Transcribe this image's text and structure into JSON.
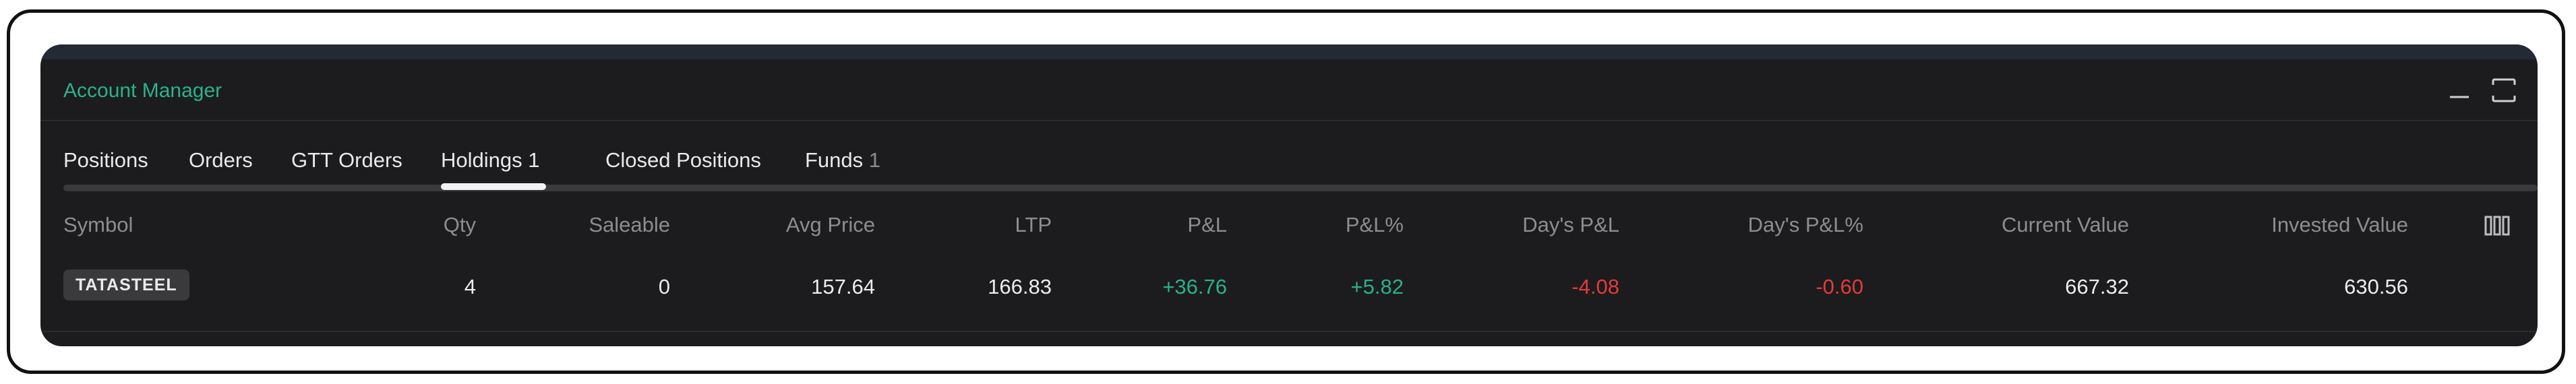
{
  "window": {
    "title": "Account Manager"
  },
  "tabs": [
    {
      "label": "Positions",
      "count": ""
    },
    {
      "label": "Orders",
      "count": ""
    },
    {
      "label": "GTT Orders",
      "count": ""
    },
    {
      "label": "Holdings",
      "count": "1"
    },
    {
      "label": "Closed Positions",
      "count": ""
    },
    {
      "label": "Funds",
      "count": "1"
    }
  ],
  "active_tab": "Holdings",
  "table": {
    "columns": [
      "Symbol",
      "Qty",
      "Saleable",
      "Avg Price",
      "LTP",
      "P&L",
      "P&L%",
      "Day's P&L",
      "Day's P&L%",
      "Current Value",
      "Invested Value"
    ],
    "rows": [
      {
        "symbol": "TATASTEEL",
        "qty": "4",
        "saleable": "0",
        "avg_price": "157.64",
        "ltp": "166.83",
        "pnl": "+36.76",
        "pnl_pct": "+5.82",
        "day_pnl": "-4.08",
        "day_pnl_pct": "-0.60",
        "current_value": "667.32",
        "invested_value": "630.56"
      }
    ]
  },
  "icons": {
    "minimize": "minimize-icon",
    "maximize": "maximize-icon",
    "columns": "columns-icon"
  },
  "colors": {
    "accent": "#2ab38a",
    "positive": "#2bb08a",
    "negative": "#e33b3b",
    "panel_bg": "#1c1c1e"
  }
}
